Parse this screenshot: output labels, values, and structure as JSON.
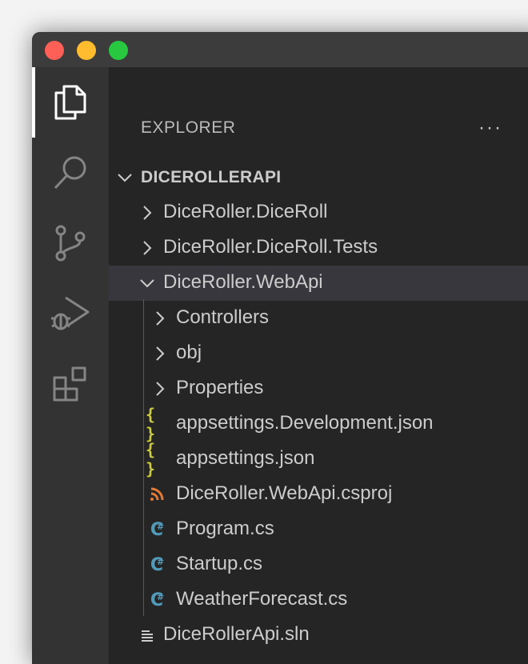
{
  "sidebar": {
    "title": "EXPLORER",
    "more_label": "···",
    "section": "DICEROLLERAPI",
    "items": [
      {
        "label": "DiceRoller.DiceRoll",
        "type": "folder",
        "expanded": false
      },
      {
        "label": "DiceRoller.DiceRoll.Tests",
        "type": "folder",
        "expanded": false
      },
      {
        "label": "DiceRoller.WebApi",
        "type": "folder",
        "expanded": true,
        "selected": true
      },
      {
        "label": "Controllers",
        "type": "folder",
        "expanded": false
      },
      {
        "label": "obj",
        "type": "folder",
        "expanded": false
      },
      {
        "label": "Properties",
        "type": "folder",
        "expanded": false
      },
      {
        "label": "appsettings.Development.json",
        "type": "json-file",
        "icon": "braces-icon"
      },
      {
        "label": "appsettings.json",
        "type": "json-file",
        "icon": "braces-icon"
      },
      {
        "label": "DiceRoller.WebApi.csproj",
        "type": "csproj-file",
        "icon": "rss-icon"
      },
      {
        "label": "Program.cs",
        "type": "cs-file",
        "icon": "csharp-icon"
      },
      {
        "label": "Startup.cs",
        "type": "cs-file",
        "icon": "csharp-icon"
      },
      {
        "label": "WeatherForecast.cs",
        "type": "cs-file",
        "icon": "csharp-icon"
      },
      {
        "label": "DiceRollerApi.sln",
        "type": "sln-file",
        "icon": "lines-icon"
      }
    ]
  },
  "activity_bar": [
    "explorer-icon",
    "search-icon",
    "source-control-icon",
    "run-debug-icon",
    "extensions-icon"
  ],
  "colors": {
    "json_icon": "#cbcb41",
    "csharp_icon": "#519aba",
    "csproj_icon": "#e37933",
    "selected_row": "#37373d"
  }
}
